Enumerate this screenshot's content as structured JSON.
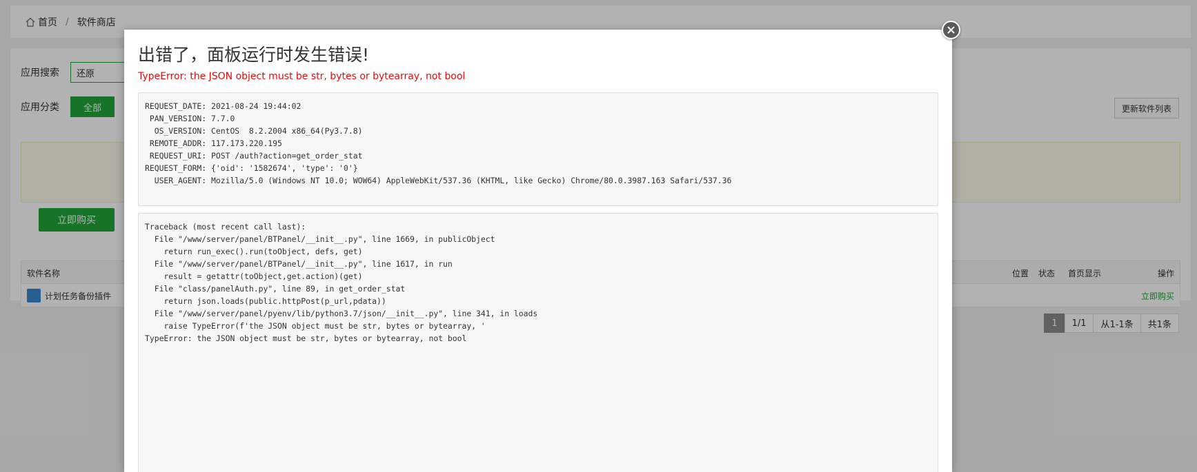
{
  "breadcrumb": {
    "home": "首页",
    "separator": "/",
    "current": "软件商店"
  },
  "search": {
    "label": "应用搜索",
    "value": "还原"
  },
  "category": {
    "label": "应用分类",
    "all_label": "全部"
  },
  "refresh_label": "更新软件列表",
  "buy_label": "立即购买",
  "table": {
    "headers": {
      "name": "软件名称",
      "position": "位置",
      "status": "状态",
      "home_display": "首页显示",
      "action": "操作"
    },
    "rows": [
      {
        "name": "计划任务备份插件",
        "action": "立即购买"
      }
    ]
  },
  "pager": {
    "current": "1",
    "pages": "1/1",
    "range": "从1-1条",
    "total": "共1条"
  },
  "modal": {
    "title": "出错了，面板运行时发生错误!",
    "error": "TypeError: the JSON object must be str, bytes or bytearray, not bool",
    "request_info": "REQUEST_DATE: 2021-08-24 19:44:02\n PAN_VERSION: 7.7.0\n  OS_VERSION: CentOS  8.2.2004 x86_64(Py3.7.8)\n REMOTE_ADDR: 117.173.220.195\n REQUEST_URI: POST /auth?action=get_order_stat\nREQUEST_FORM: {'oid': '1582674', 'type': '0'}\n  USER_AGENT: Mozilla/5.0 (Windows NT 10.0; WOW64) AppleWebKit/537.36 (KHTML, like Gecko) Chrome/80.0.3987.163 Safari/537.36",
    "traceback": "Traceback (most recent call last):\n  File \"/www/server/panel/BTPanel/__init__.py\", line 1669, in publicObject\n    return run_exec().run(toObject, defs, get)\n  File \"/www/server/panel/BTPanel/__init__.py\", line 1617, in run\n    result = getattr(toObject,get.action)(get)\n  File \"class/panelAuth.py\", line 89, in get_order_stat\n    return json.loads(public.httpPost(p_url,pdata))\n  File \"/www/server/panel/pyenv/lib/python3.7/json/__init__.py\", line 341, in loads\n    raise TypeError(f'the JSON object must be str, bytes or bytearray, '\nTypeError: the JSON object must be str, bytes or bytearray, not bool"
  },
  "colors": {
    "accent": "#20a53a",
    "error": "#ef0808"
  },
  "icons": {
    "home": "home-icon",
    "plugin": "plugin-icon",
    "close": "close-icon"
  }
}
